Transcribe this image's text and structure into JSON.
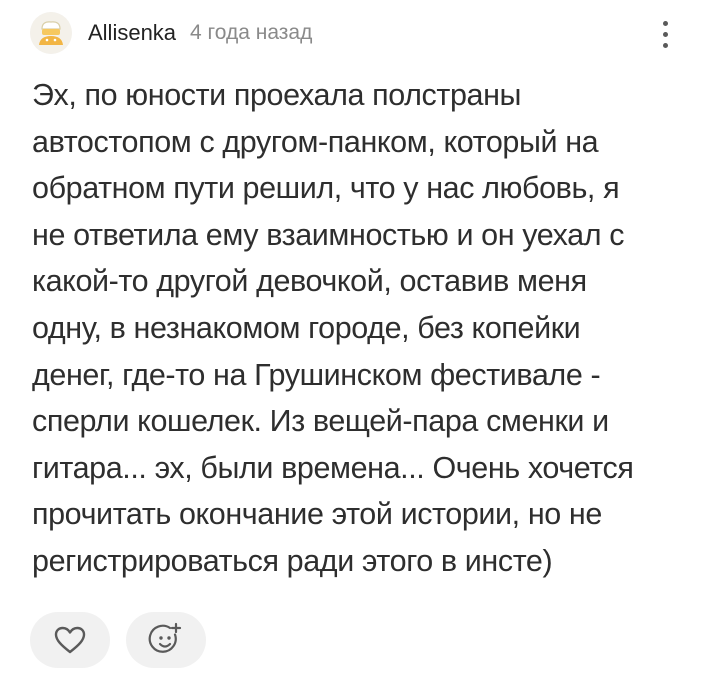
{
  "comment": {
    "author": "Allisenka",
    "timestamp": "4 года назад",
    "text_lines": [
      "Эх, по юности проехала полстраны",
      "автостопом с другом-панком, который на",
      "обратном пути решил, что у нас любовь, я",
      "не ответила ему взаимностью и он уехал с",
      "какой-то другой девочкой, оставив меня",
      "одну, в незнакомом городе, без копейки",
      "денег, где-то на Грушинском фестивале -",
      "сперли кошелек. Из вещей-пара сменки и",
      "гитара... эх, были времена... Очень хочется",
      "прочитать окончание этой истории, но не",
      "регистрироваться ради этого в инсте)"
    ],
    "actions": {
      "like_icon": "heart-icon",
      "react_icon": "add-emoji-icon"
    }
  },
  "colors": {
    "text": "#2e2e2e",
    "muted": "#8a8a8a",
    "button_bg": "#f1f1f1",
    "icon": "#5a5a5a"
  }
}
